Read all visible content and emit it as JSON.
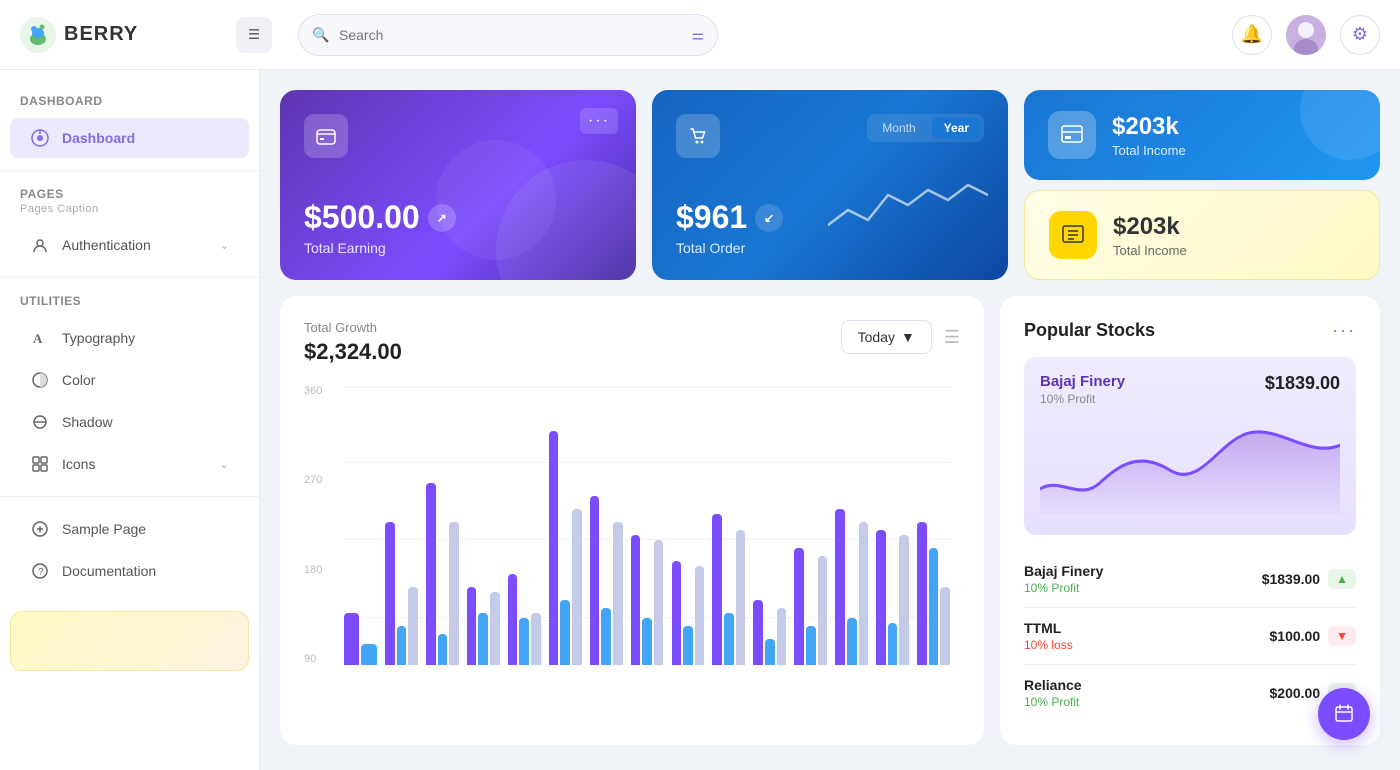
{
  "header": {
    "logo_text": "BERRY",
    "search_placeholder": "Search",
    "menu_icon": "☰"
  },
  "sidebar": {
    "section_dashboard": "Dashboard",
    "item_dashboard": "Dashboard",
    "section_pages": "Pages",
    "pages_caption": "Pages Caption",
    "item_authentication": "Authentication",
    "section_utilities": "Utilities",
    "item_typography": "Typography",
    "item_color": "Color",
    "item_shadow": "Shadow",
    "item_icons": "Icons",
    "item_sample_page": "Sample Page",
    "item_documentation": "Documentation"
  },
  "cards": {
    "earning_amount": "$500.00",
    "earning_label": "Total Earning",
    "order_amount": "$961",
    "order_label": "Total Order",
    "toggle_month": "Month",
    "toggle_year": "Year",
    "income_top_amount": "$203k",
    "income_top_label": "Total Income",
    "income_bottom_amount": "$203k",
    "income_bottom_label": "Total Income"
  },
  "chart": {
    "title": "Total Growth",
    "amount": "$2,324.00",
    "btn_label": "Today",
    "y_labels": [
      "360",
      "270",
      "180",
      "90"
    ],
    "bars": [
      {
        "purple": 20,
        "blue": 8,
        "light": 0
      },
      {
        "purple": 55,
        "blue": 15,
        "light": 30
      },
      {
        "purple": 70,
        "blue": 12,
        "light": 55
      },
      {
        "purple": 30,
        "blue": 20,
        "light": 28
      },
      {
        "purple": 35,
        "blue": 18,
        "light": 20
      },
      {
        "purple": 90,
        "blue": 25,
        "light": 60
      },
      {
        "purple": 65,
        "blue": 22,
        "light": 55
      },
      {
        "purple": 50,
        "blue": 18,
        "light": 48
      },
      {
        "purple": 40,
        "blue": 15,
        "light": 38
      },
      {
        "purple": 58,
        "blue": 20,
        "light": 52
      },
      {
        "purple": 25,
        "blue": 10,
        "light": 22
      },
      {
        "purple": 45,
        "blue": 15,
        "light": 42
      },
      {
        "purple": 60,
        "blue": 18,
        "light": 55
      },
      {
        "purple": 52,
        "blue": 16,
        "light": 50
      },
      {
        "purple": 55,
        "blue": 45,
        "light": 30
      }
    ]
  },
  "stocks": {
    "title": "Popular Stocks",
    "stock_chart_name": "Bajaj Finery",
    "stock_chart_profit": "10% Profit",
    "stock_chart_price": "$1839.00",
    "items": [
      {
        "name": "Bajaj Finery",
        "profit": "10% Profit",
        "price": "$1839.00",
        "trend": "up"
      },
      {
        "name": "TTML",
        "profit": "10% loss",
        "price": "$100.00",
        "trend": "down"
      },
      {
        "name": "Reliance",
        "profit": "10% Profit",
        "price": "$200.00",
        "trend": "up"
      }
    ]
  }
}
